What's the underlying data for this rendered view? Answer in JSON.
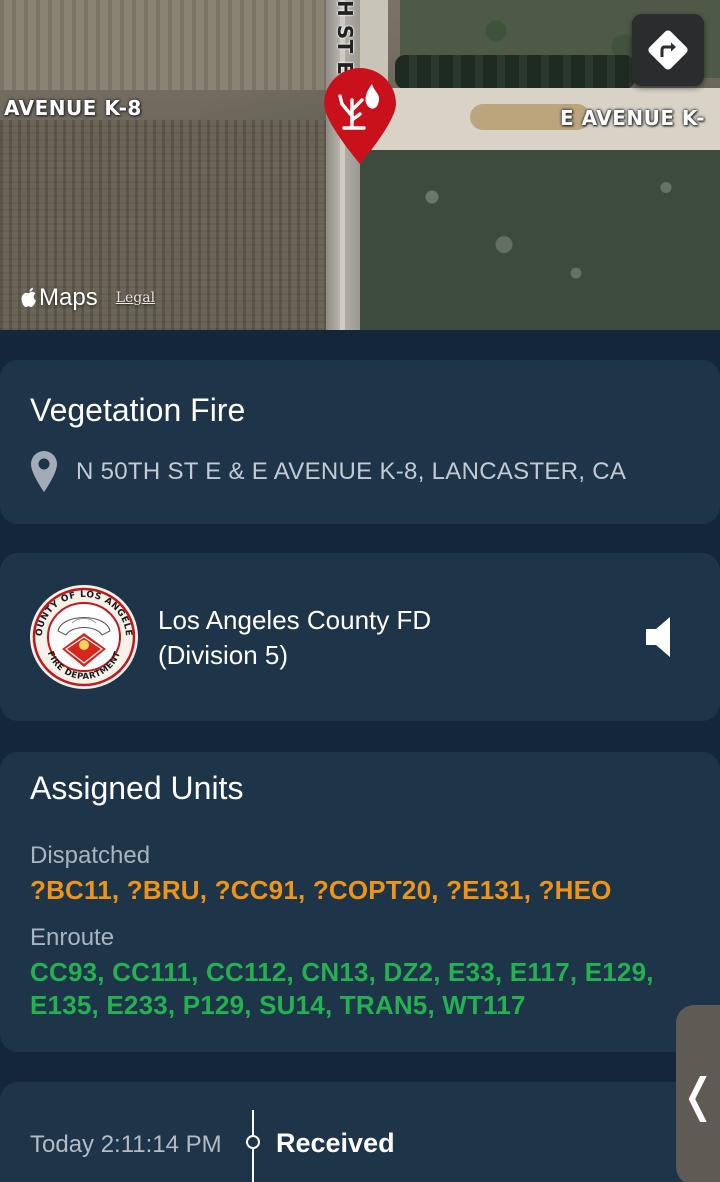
{
  "map": {
    "labels": {
      "avenue_left": "AVENUE K-8",
      "avenue_right": "E AVENUE K-",
      "street": "H ST E"
    },
    "brand": "Maps",
    "legal": "Legal",
    "pin_color": "#c9111c"
  },
  "incident": {
    "title": "Vegetation Fire",
    "location": "N 50TH ST E & E AVENUE K-8, LANCASTER, CA"
  },
  "agency": {
    "name_line1": "Los Angeles County FD",
    "name_line2": "(Division 5)",
    "logo_text_top": "COUNTY OF LOS ANGELES",
    "logo_text_bottom": "FIRE DEPARTMENT"
  },
  "units": {
    "title": "Assigned Units",
    "dispatched_label": "Dispatched",
    "dispatched": "?BC11, ?BRU, ?CC91, ?COPT20, ?E131, ?HEO",
    "enroute_label": "Enroute",
    "enroute": "CC93, CC111, CC112, CN13, DZ2, E33, E117, E129, E135, E233, P129, SU14, TRAN5, WT117"
  },
  "timeline": {
    "time": "Today 2:11:14 PM",
    "status": "Received"
  },
  "side_tab": {
    "glyph": "❬"
  },
  "colors": {
    "background": "#14273a",
    "card": "#1e3448",
    "dispatched": "#ef9516",
    "enroute": "#23b24f"
  }
}
